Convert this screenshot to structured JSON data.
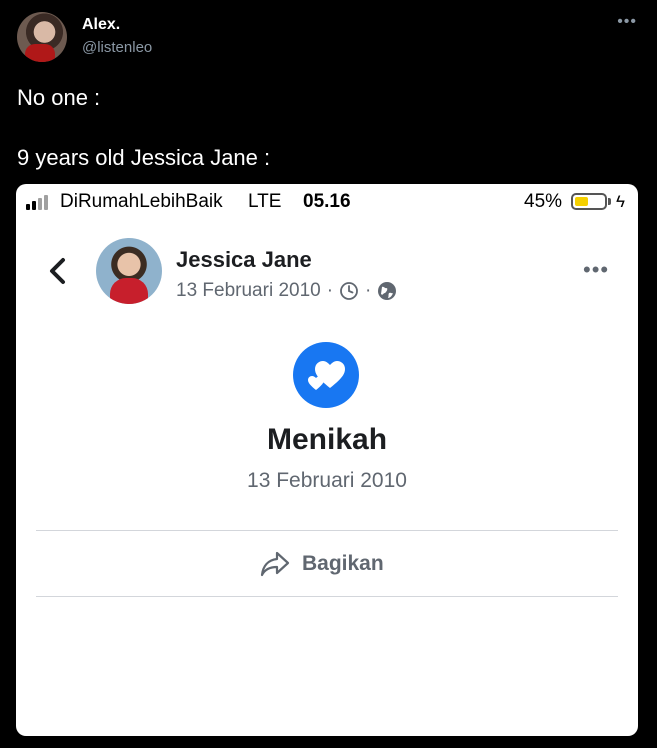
{
  "tweet": {
    "author_name": "Alex.",
    "author_handle": "@listenleo",
    "more_icon": "more-horizontal-icon",
    "text_line1": "No one :",
    "text_line2": "9 years old Jessica Jane :"
  },
  "embed": {
    "status_bar": {
      "carrier": "DiRumahLebihBaik",
      "network": "LTE",
      "time": "05.16",
      "battery_percent": "45%",
      "battery_level": 0.45,
      "battery_color": "#f5d000"
    },
    "post": {
      "profile_name": "Jessica Jane",
      "date": "13 Februari 2010",
      "meta_separator": "·",
      "event_icon": "hearts-icon",
      "event_icon_color": "#1877f2",
      "event_title": "Menikah",
      "event_date": "13 Februari 2010",
      "share_label": "Bagikan"
    }
  }
}
